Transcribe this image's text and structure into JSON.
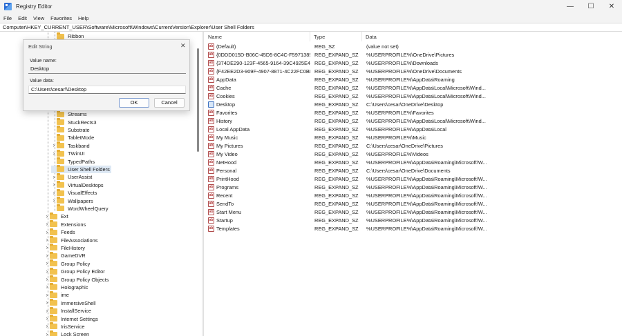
{
  "window": {
    "title": "Registry Editor",
    "minimize": "—",
    "maximize": "☐",
    "close": "✕"
  },
  "menu": [
    "File",
    "Edit",
    "View",
    "Favorites",
    "Help"
  ],
  "address": "Computer\\HKEY_CURRENT_USER\\Software\\Microsoft\\Windows\\CurrentVersion\\Explorer\\User Shell Folders",
  "tree": {
    "items": [
      {
        "label": "Ribbon",
        "chevron": false,
        "level": 2,
        "selected": false
      },
      {
        "label": "Streams",
        "chevron": false,
        "level": 2,
        "selected": false
      },
      {
        "label": "StuckRects3",
        "chevron": false,
        "level": 2,
        "selected": false
      },
      {
        "label": "Substrate",
        "chevron": false,
        "level": 2,
        "selected": false
      },
      {
        "label": "TabletMode",
        "chevron": false,
        "level": 2,
        "selected": false
      },
      {
        "label": "Taskband",
        "chevron": true,
        "level": 2,
        "selected": false
      },
      {
        "label": "TWinUI",
        "chevron": true,
        "level": 2,
        "selected": false
      },
      {
        "label": "TypedPaths",
        "chevron": false,
        "level": 2,
        "selected": false
      },
      {
        "label": "User Shell Folders",
        "chevron": false,
        "level": 2,
        "selected": true
      },
      {
        "label": "UserAssist",
        "chevron": true,
        "level": 2,
        "selected": false
      },
      {
        "label": "VirtualDesktops",
        "chevron": true,
        "level": 2,
        "selected": false
      },
      {
        "label": "VisualEffects",
        "chevron": true,
        "level": 2,
        "selected": false
      },
      {
        "label": "Wallpapers",
        "chevron": true,
        "level": 2,
        "selected": false
      },
      {
        "label": "WordWheelQuery",
        "chevron": false,
        "level": 2,
        "selected": false
      },
      {
        "label": "Ext",
        "chevron": true,
        "level": 1,
        "selected": false
      },
      {
        "label": "Extensions",
        "chevron": true,
        "level": 1,
        "selected": false
      },
      {
        "label": "Feeds",
        "chevron": true,
        "level": 1,
        "selected": false
      },
      {
        "label": "FileAssociations",
        "chevron": true,
        "level": 1,
        "selected": false
      },
      {
        "label": "FileHistory",
        "chevron": true,
        "level": 1,
        "selected": false
      },
      {
        "label": "GameDVR",
        "chevron": true,
        "level": 1,
        "selected": false
      },
      {
        "label": "Group Policy",
        "chevron": true,
        "level": 1,
        "selected": false
      },
      {
        "label": "Group Policy Editor",
        "chevron": true,
        "level": 1,
        "selected": false
      },
      {
        "label": "Group Policy Objects",
        "chevron": true,
        "level": 1,
        "selected": false
      },
      {
        "label": "Holographic",
        "chevron": true,
        "level": 1,
        "selected": false
      },
      {
        "label": "ime",
        "chevron": true,
        "level": 1,
        "selected": false
      },
      {
        "label": "ImmersiveShell",
        "chevron": true,
        "level": 1,
        "selected": false
      },
      {
        "label": "InstallService",
        "chevron": true,
        "level": 1,
        "selected": false
      },
      {
        "label": "Internet Settings",
        "chevron": true,
        "level": 1,
        "selected": false
      },
      {
        "label": "IrisService",
        "chevron": true,
        "level": 1,
        "selected": false
      },
      {
        "label": "Lock Screen",
        "chevron": true,
        "level": 1,
        "selected": false
      }
    ]
  },
  "list": {
    "columns": [
      "Name",
      "Type",
      "Data"
    ],
    "rows": [
      {
        "name": "(Default)",
        "type": "REG_SZ",
        "data": "(value not set)",
        "icon": "ab"
      },
      {
        "name": "{0DDD015D-B06C-45D5-8C4C-F59713854...",
        "type": "REG_EXPAND_SZ",
        "data": "%USERPROFILE%\\OneDrive\\Pictures",
        "icon": "ab"
      },
      {
        "name": "{374DE290-123F-4565-9164-39C4925E46...",
        "type": "REG_EXPAND_SZ",
        "data": "%USERPROFILE%\\Downloads",
        "icon": "ab"
      },
      {
        "name": "{F42EE2D3-909F-4907-8871-4C22FC0BF...",
        "type": "REG_EXPAND_SZ",
        "data": "%USERPROFILE%\\OneDrive\\Documents",
        "icon": "ab"
      },
      {
        "name": "AppData",
        "type": "REG_EXPAND_SZ",
        "data": "%USERPROFILE%\\AppData\\Roaming",
        "icon": "ab"
      },
      {
        "name": "Cache",
        "type": "REG_EXPAND_SZ",
        "data": "%USERPROFILE%\\AppData\\Local\\Microsoft\\Wind...",
        "icon": "ab"
      },
      {
        "name": "Cookies",
        "type": "REG_EXPAND_SZ",
        "data": "%USERPROFILE%\\AppData\\Local\\Microsoft\\Wind...",
        "icon": "ab"
      },
      {
        "name": "Desktop",
        "type": "REG_EXPAND_SZ",
        "data": "C:\\Users\\cesar\\OneDrive\\Desktop",
        "icon": "desktop"
      },
      {
        "name": "Favorites",
        "type": "REG_EXPAND_SZ",
        "data": "%USERPROFILE%\\Favorites",
        "icon": "ab"
      },
      {
        "name": "History",
        "type": "REG_EXPAND_SZ",
        "data": "%USERPROFILE%\\AppData\\Local\\Microsoft\\Wind...",
        "icon": "ab"
      },
      {
        "name": "Local AppData",
        "type": "REG_EXPAND_SZ",
        "data": "%USERPROFILE%\\AppData\\Local",
        "icon": "ab"
      },
      {
        "name": "My Music",
        "type": "REG_EXPAND_SZ",
        "data": "%USERPROFILE%\\Music",
        "icon": "ab"
      },
      {
        "name": "My Pictures",
        "type": "REG_EXPAND_SZ",
        "data": "C:\\Users\\cesar\\OneDrive\\Pictures",
        "icon": "ab"
      },
      {
        "name": "My Video",
        "type": "REG_EXPAND_SZ",
        "data": "%USERPROFILE%\\Videos",
        "icon": "ab"
      },
      {
        "name": "NetHood",
        "type": "REG_EXPAND_SZ",
        "data": "%USERPROFILE%\\AppData\\Roaming\\Microsoft\\W...",
        "icon": "ab"
      },
      {
        "name": "Personal",
        "type": "REG_EXPAND_SZ",
        "data": "C:\\Users\\cesar\\OneDrive\\Documents",
        "icon": "ab"
      },
      {
        "name": "PrintHood",
        "type": "REG_EXPAND_SZ",
        "data": "%USERPROFILE%\\AppData\\Roaming\\Microsoft\\W...",
        "icon": "ab"
      },
      {
        "name": "Programs",
        "type": "REG_EXPAND_SZ",
        "data": "%USERPROFILE%\\AppData\\Roaming\\Microsoft\\W...",
        "icon": "ab"
      },
      {
        "name": "Recent",
        "type": "REG_EXPAND_SZ",
        "data": "%USERPROFILE%\\AppData\\Roaming\\Microsoft\\W...",
        "icon": "ab"
      },
      {
        "name": "SendTo",
        "type": "REG_EXPAND_SZ",
        "data": "%USERPROFILE%\\AppData\\Roaming\\Microsoft\\W...",
        "icon": "ab"
      },
      {
        "name": "Start Menu",
        "type": "REG_EXPAND_SZ",
        "data": "%USERPROFILE%\\AppData\\Roaming\\Microsoft\\W...",
        "icon": "ab"
      },
      {
        "name": "Startup",
        "type": "REG_EXPAND_SZ",
        "data": "%USERPROFILE%\\AppData\\Roaming\\Microsoft\\W...",
        "icon": "ab"
      },
      {
        "name": "Templates",
        "type": "REG_EXPAND_SZ",
        "data": "%USERPROFILE%\\AppData\\Roaming\\Microsoft\\W...",
        "icon": "ab"
      }
    ]
  },
  "dialog": {
    "title": "Edit String",
    "value_name_label": "Value name:",
    "value_name": "Desktop",
    "value_data_label": "Value data:",
    "value_data": "C:\\Users\\cesar\\\\Desktop",
    "ok": "OK",
    "cancel": "Cancel",
    "close": "✕"
  }
}
